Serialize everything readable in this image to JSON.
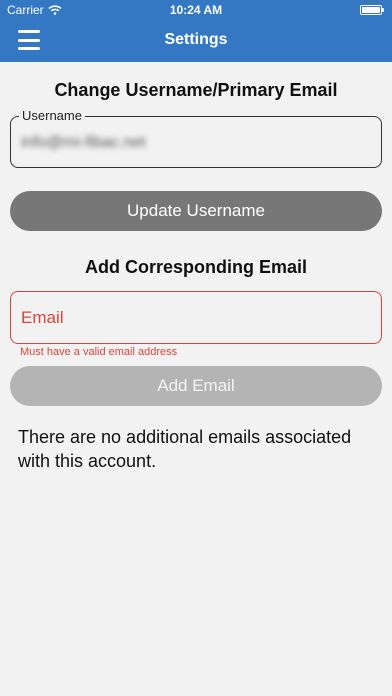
{
  "status_bar": {
    "carrier": "Carrier",
    "time": "10:24 AM"
  },
  "navbar": {
    "title": "Settings",
    "menu_icon": "hamburger-menu-icon"
  },
  "username_section": {
    "title": "Change Username/Primary Email",
    "field_label": "Username",
    "field_value": "info@mi-fibac.net",
    "button_label": "Update Username"
  },
  "email_section": {
    "title": "Add Corresponding Email",
    "placeholder": "Email",
    "error": "Must have a valid email address",
    "button_label": "Add Email"
  },
  "info_text": "There are no additional emails associated with this account.",
  "colors": {
    "brand": "#3478c4",
    "error": "#d9443c"
  }
}
